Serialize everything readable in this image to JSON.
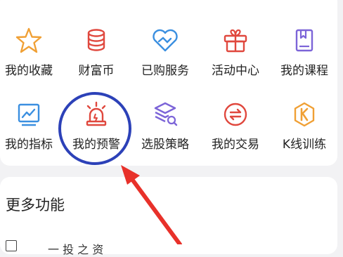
{
  "grid": {
    "row1": [
      {
        "label": "我的收藏",
        "icon": "star-icon"
      },
      {
        "label": "财富币",
        "icon": "coin-stack-icon"
      },
      {
        "label": "已购服务",
        "icon": "heart-diamond-icon"
      },
      {
        "label": "活动中心",
        "icon": "gift-icon"
      },
      {
        "label": "我的课程",
        "icon": "book-icon"
      }
    ],
    "row2": [
      {
        "label": "我的指标",
        "icon": "chart-indicator-icon"
      },
      {
        "label": "我的预警",
        "icon": "alarm-siren-icon"
      },
      {
        "label": "选股策略",
        "icon": "strategy-layers-icon"
      },
      {
        "label": "我的交易",
        "icon": "exchange-icon"
      },
      {
        "label": "K线训练",
        "icon": "k-line-icon"
      }
    ]
  },
  "more": {
    "title": "更多功能",
    "first_item_partial": "一 投 之 资"
  },
  "annotation": {
    "highlight_color": "#2c41b8",
    "arrow_color": "#e8312a"
  },
  "colors": {
    "orange": "#f0a035",
    "red": "#e0483e",
    "blue": "#3a8fe0",
    "purple": "#7c64d8"
  }
}
